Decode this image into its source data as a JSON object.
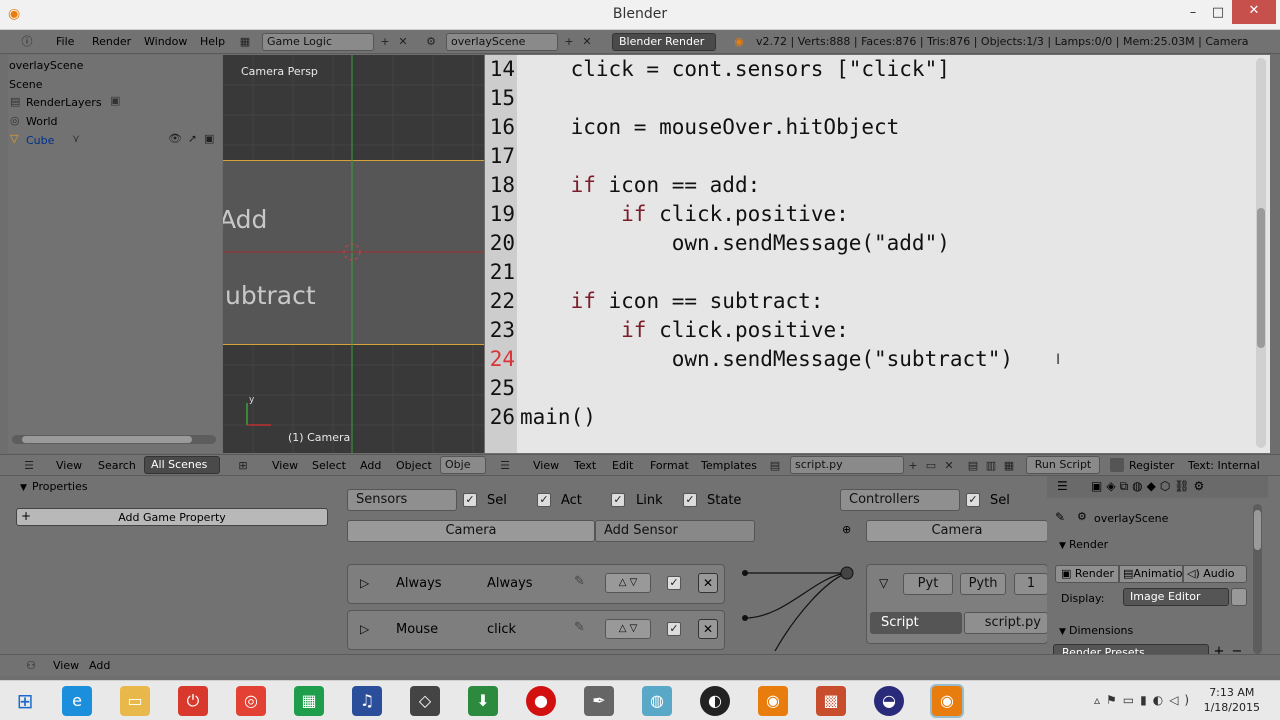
{
  "window": {
    "title": "Blender",
    "minimize_glyph": "–",
    "maximize_glyph": "□",
    "close_glyph": "✕"
  },
  "menubar": {
    "menus": [
      "File",
      "Render",
      "Window",
      "Help"
    ],
    "screen_layout": "Game Logic",
    "scene": "overlayScene",
    "engine": "Blender Render",
    "stats": "v2.72 | Verts:888 | Faces:876 | Tris:876 | Objects:1/3 | Lamps:0/0 | Mem:25.03M | Camera"
  },
  "outliner": {
    "items": [
      {
        "label": "overlayScene"
      },
      {
        "label": "Scene"
      },
      {
        "label": "RenderLayers"
      },
      {
        "label": "World"
      },
      {
        "label": "Cube"
      }
    ]
  },
  "viewport": {
    "title": "Camera Persp",
    "footer": "(1) Camera",
    "text_add": "Add",
    "text_subtract": "ubtract",
    "axis_y": "y"
  },
  "code": {
    "lines": [
      {
        "n": "14",
        "text": "    click = cont.sensors [\"click\"]"
      },
      {
        "n": "15",
        "text": ""
      },
      {
        "n": "16",
        "text": "    icon = mouseOver.hitObject"
      },
      {
        "n": "17",
        "text": ""
      },
      {
        "n": "18",
        "text": "    if icon == add:"
      },
      {
        "n": "19",
        "text": "        if click.positive:"
      },
      {
        "n": "20",
        "text": "            own.sendMessage(\"add\")"
      },
      {
        "n": "21",
        "text": ""
      },
      {
        "n": "22",
        "text": "    if icon == subtract:"
      },
      {
        "n": "23",
        "text": "        if click.positive:"
      },
      {
        "n": "24",
        "text": "            own.sendMessage(\"subtract\")"
      },
      {
        "n": "25",
        "text": ""
      },
      {
        "n": "26",
        "text": "main()"
      }
    ],
    "current_line": "24"
  },
  "headers": {
    "outliner": {
      "view": "View",
      "search": "Search",
      "scenes": "All Scenes"
    },
    "viewport": {
      "view": "View",
      "select": "Select",
      "add": "Add",
      "object": "Object",
      "mode": "Obje"
    },
    "text": {
      "view": "View",
      "text": "Text",
      "edit": "Edit",
      "format": "Format",
      "templates": "Templates",
      "file": "script.py",
      "run": "Run Script",
      "register": "Register",
      "internal": "Text: Internal"
    }
  },
  "properties": {
    "title": "Properties",
    "add": "Add Game Property"
  },
  "logic": {
    "sensors_label": "Sensors",
    "sel": "Sel",
    "act": "Act",
    "link": "Link",
    "state": "State",
    "object": "Camera",
    "add_sensor": "Add Sensor",
    "sensors": [
      {
        "type": "Always",
        "name": "Always"
      },
      {
        "type": "Mouse",
        "name": "click"
      }
    ],
    "controllers_label": "Controllers",
    "controllers_object": "Camera",
    "ctrl_type": "Pyt",
    "ctrl_name": "Pyth",
    "ctrl_num": "1",
    "script_mode": "Script",
    "script_file": "script.py"
  },
  "render_panel": {
    "scene": "overlayScene",
    "render_section": "Render",
    "buttons": [
      "Render",
      "Animatio",
      "Audio"
    ],
    "display_label": "Display:",
    "display_value": "Image Editor",
    "dimensions": "Dimensions",
    "presets": "Render Presets"
  },
  "footer": {
    "view": "View",
    "add": "Add"
  },
  "taskbar": {
    "time": "7:13 AM",
    "date": "1/18/2015"
  }
}
